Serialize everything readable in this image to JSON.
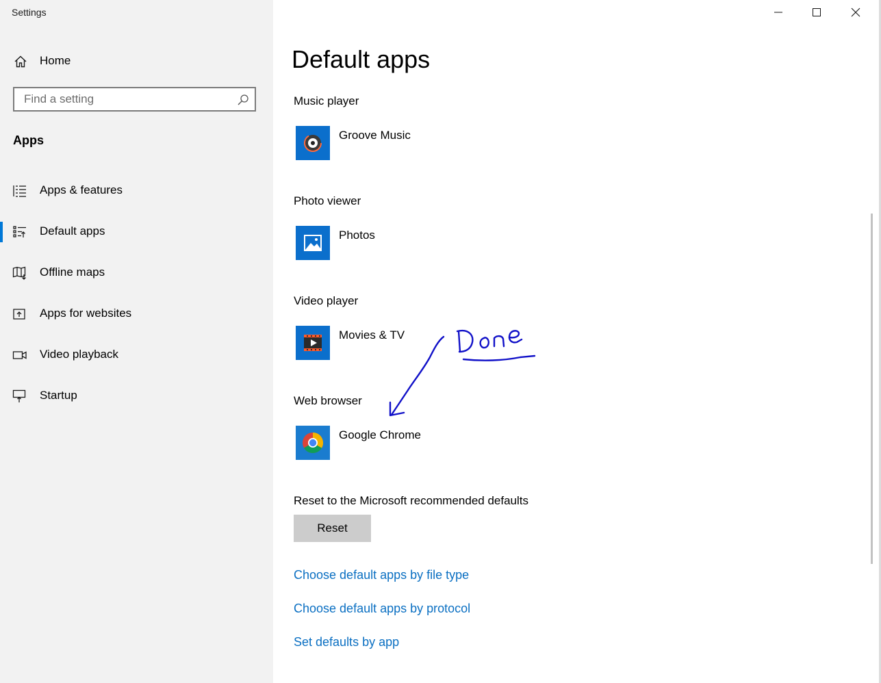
{
  "window": {
    "title": "Settings"
  },
  "sidebar": {
    "home_label": "Home",
    "search": {
      "placeholder": "Find a setting",
      "value": ""
    },
    "section_title": "Apps",
    "items": [
      {
        "label": "Apps & features",
        "icon": "list-icon",
        "selected": false
      },
      {
        "label": "Default apps",
        "icon": "default-apps-icon",
        "selected": true
      },
      {
        "label": "Offline maps",
        "icon": "map-icon",
        "selected": false
      },
      {
        "label": "Apps for websites",
        "icon": "open-external-icon",
        "selected": false
      },
      {
        "label": "Video playback",
        "icon": "video-camera-icon",
        "selected": false
      },
      {
        "label": "Startup",
        "icon": "startup-icon",
        "selected": false
      }
    ]
  },
  "main": {
    "title": "Default apps",
    "categories": [
      {
        "label": "Music player",
        "app": "Groove Music",
        "icon": "groove-music-icon"
      },
      {
        "label": "Photo viewer",
        "app": "Photos",
        "icon": "photos-icon"
      },
      {
        "label": "Video player",
        "app": "Movies & TV",
        "icon": "movies-tv-icon"
      },
      {
        "label": "Web browser",
        "app": "Google Chrome",
        "icon": "chrome-icon"
      }
    ],
    "reset": {
      "label": "Reset to the Microsoft recommended defaults",
      "button": "Reset"
    },
    "links": [
      "Choose default apps by file type",
      "Choose default apps by protocol",
      "Set defaults by app"
    ]
  },
  "annotation": {
    "text": "Done",
    "color": "#1010c8"
  },
  "colors": {
    "accent": "#0078d7",
    "link": "#0a6fc2",
    "sidebar_bg": "#f2f2f2",
    "tile_bg": "#0b6fcc"
  }
}
